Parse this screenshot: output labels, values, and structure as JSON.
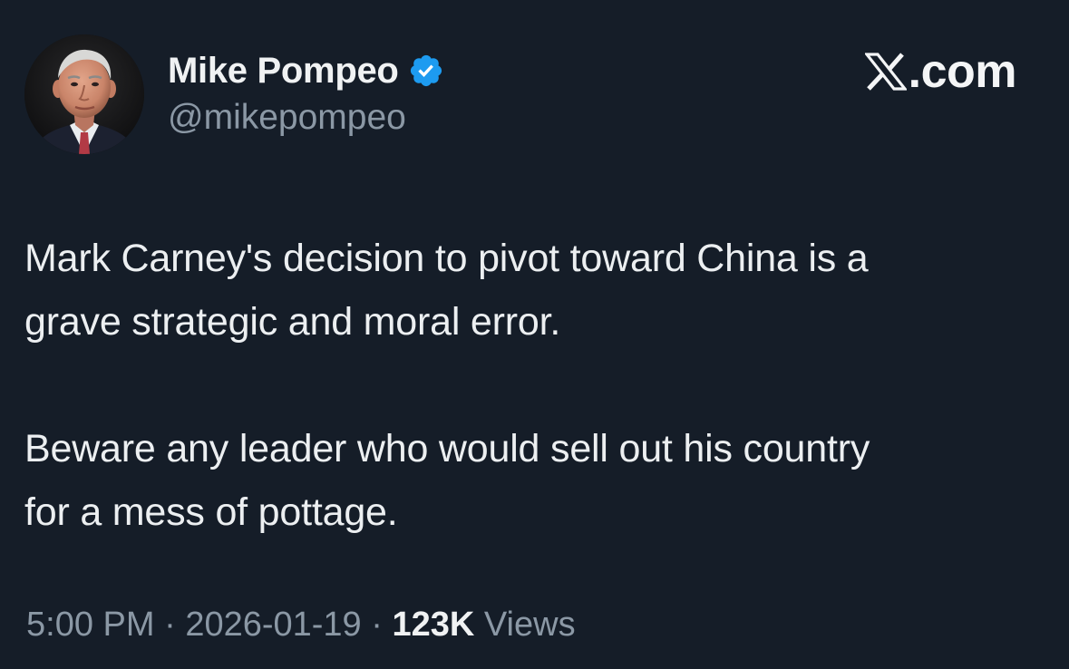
{
  "author": {
    "name": "Mike Pompeo",
    "handle": "@mikepompeo",
    "verified": true
  },
  "brand": {
    "label": ".com",
    "logo_icon": "x-logo-icon"
  },
  "tweet": {
    "lines": [
      "Mark Carney's decision to pivot toward China is a",
      "grave strategic and moral error.",
      "Beware any leader who would sell out his country",
      "for a mess of pottage."
    ]
  },
  "meta": {
    "time": "5:00 PM",
    "separator": "·",
    "date": "2026-01-19",
    "views_count": "123K",
    "views_label": "Views"
  },
  "colors": {
    "background": "#151d28",
    "text_primary": "#eceff1",
    "text_secondary": "#8b98a5",
    "verified_badge": "#1d9bf0"
  }
}
